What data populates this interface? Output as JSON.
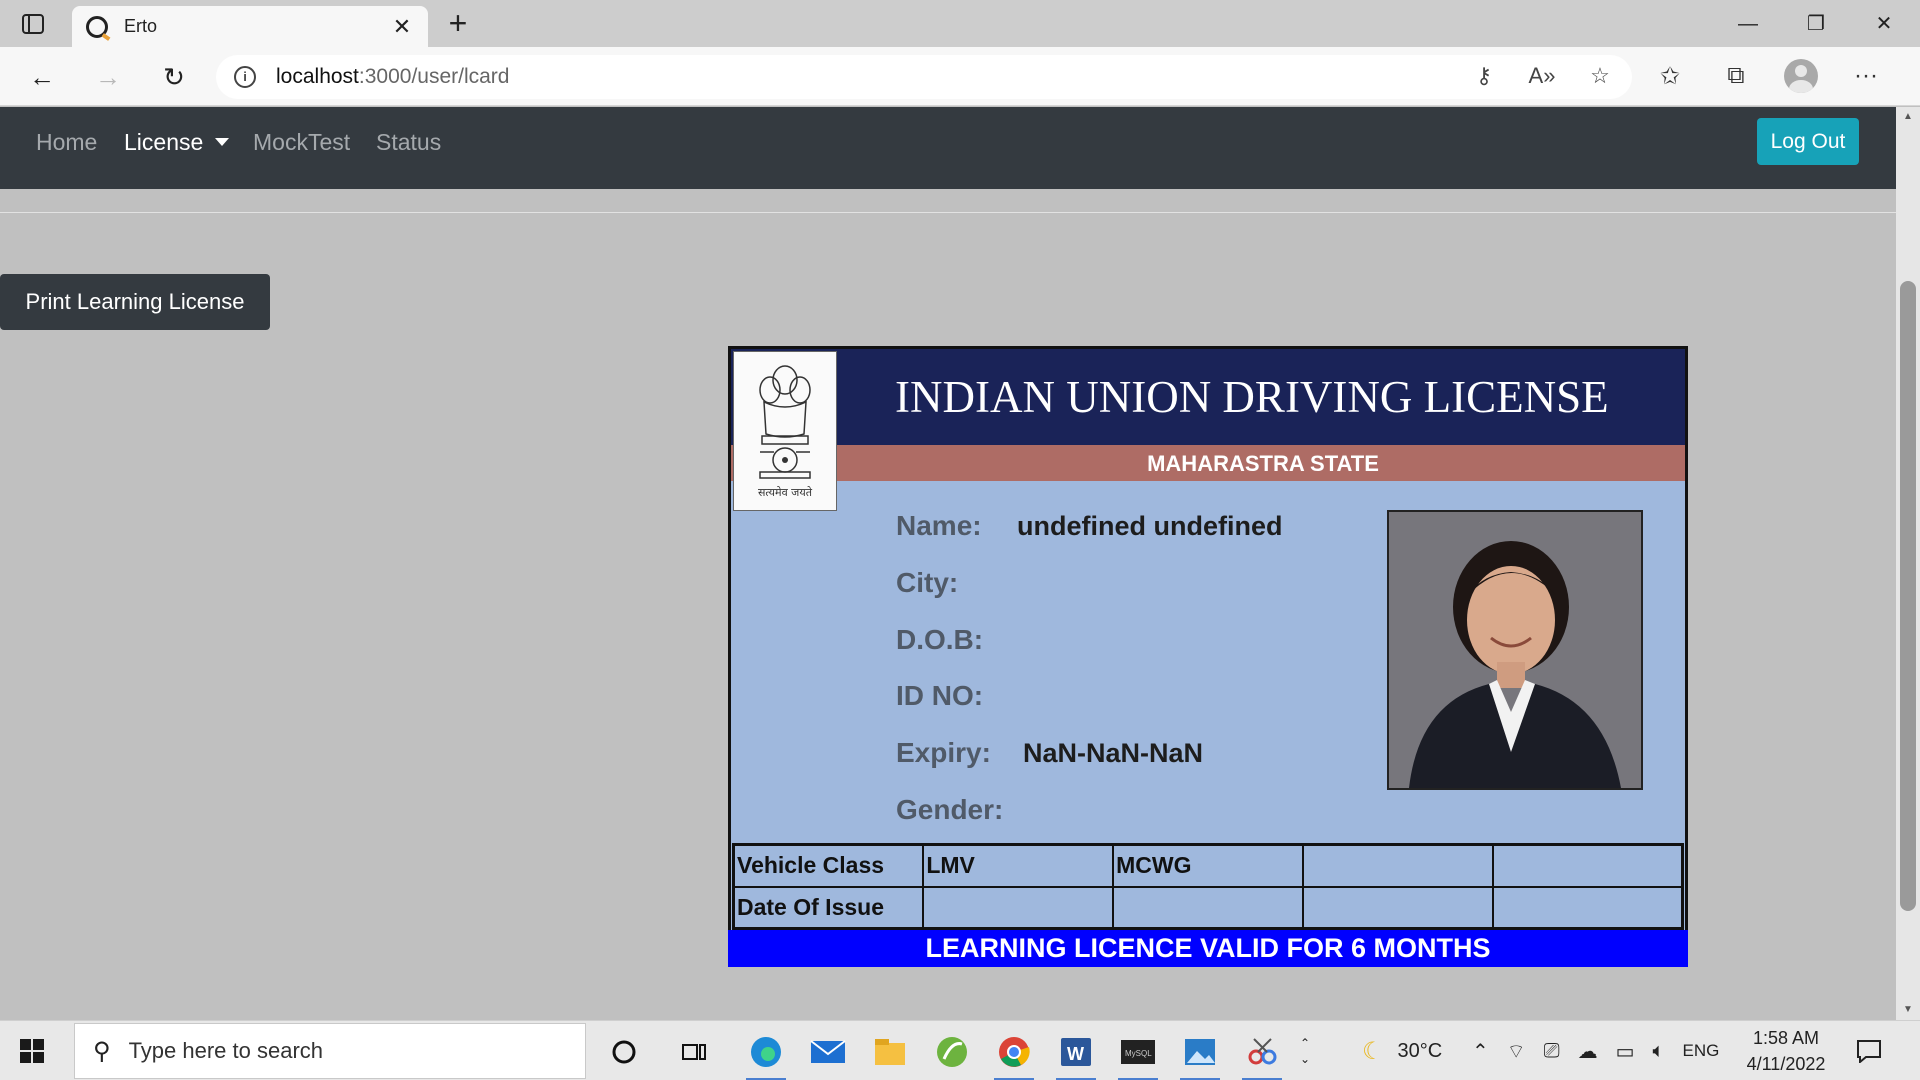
{
  "browser": {
    "tab_title": "Erto",
    "url_host": "localhost",
    "url_path": ":3000/user/lcard",
    "icons": {
      "tab_actions": "tab-actions-icon",
      "favicon": "erto-favicon-icon",
      "close_tab": "close-icon",
      "new_tab": "plus-icon",
      "back": "back-arrow-icon",
      "forward": "forward-arrow-icon",
      "reload": "reload-icon",
      "site_info": "info-icon",
      "key": "key-icon",
      "read_aloud": "read-aloud-icon",
      "add_favorite": "star-add-icon",
      "favorites": "favorites-icon",
      "collections": "collections-icon",
      "profile": "profile-avatar-icon",
      "more": "more-icon"
    }
  },
  "navbar": {
    "items": [
      "Home",
      "License",
      "MockTest",
      "Status"
    ],
    "logout": "Log Out",
    "colors": {
      "background": "#343a40",
      "logout": "#17a2b8"
    }
  },
  "actions": {
    "print": "Print Learning License"
  },
  "card": {
    "title": "INDIAN UNION DRIVING LICENSE",
    "state": "MAHARASTRA STATE",
    "emblem_caption": "सत्यमेव जयते",
    "fields": {
      "name_label": "Name:",
      "name_value": "undefined undefined",
      "city_label": "City:",
      "dob_label": "D.O.B:",
      "id_label": "ID NO:",
      "expiry_label": "Expiry:",
      "expiry_value": "NaN-NaN-NaN",
      "gender_label": "Gender:"
    },
    "table": {
      "rows": [
        [
          "Vehicle Class",
          "LMV",
          "MCWG",
          "",
          ""
        ],
        [
          "Date Of Issue",
          "",
          "",
          "",
          ""
        ]
      ]
    },
    "footer": "LEARNING LICENCE VALID FOR 6 MONTHS",
    "colors": {
      "header": "#1a2358",
      "state_band": "#ae6c65",
      "body": "#9fb8dd",
      "footer": "#0000ff"
    }
  },
  "taskbar": {
    "search_placeholder": "Type here to search",
    "weather": "30°C",
    "language": "ENG",
    "time": "1:58 AM",
    "date": "4/11/2022",
    "apps": [
      "cortana-icon",
      "task-view-icon",
      "edge-icon",
      "mail-icon",
      "file-explorer-icon",
      "spring-icon",
      "chrome-icon",
      "word-icon",
      "mysql-icon",
      "photos-icon",
      "snipping-icon"
    ]
  }
}
